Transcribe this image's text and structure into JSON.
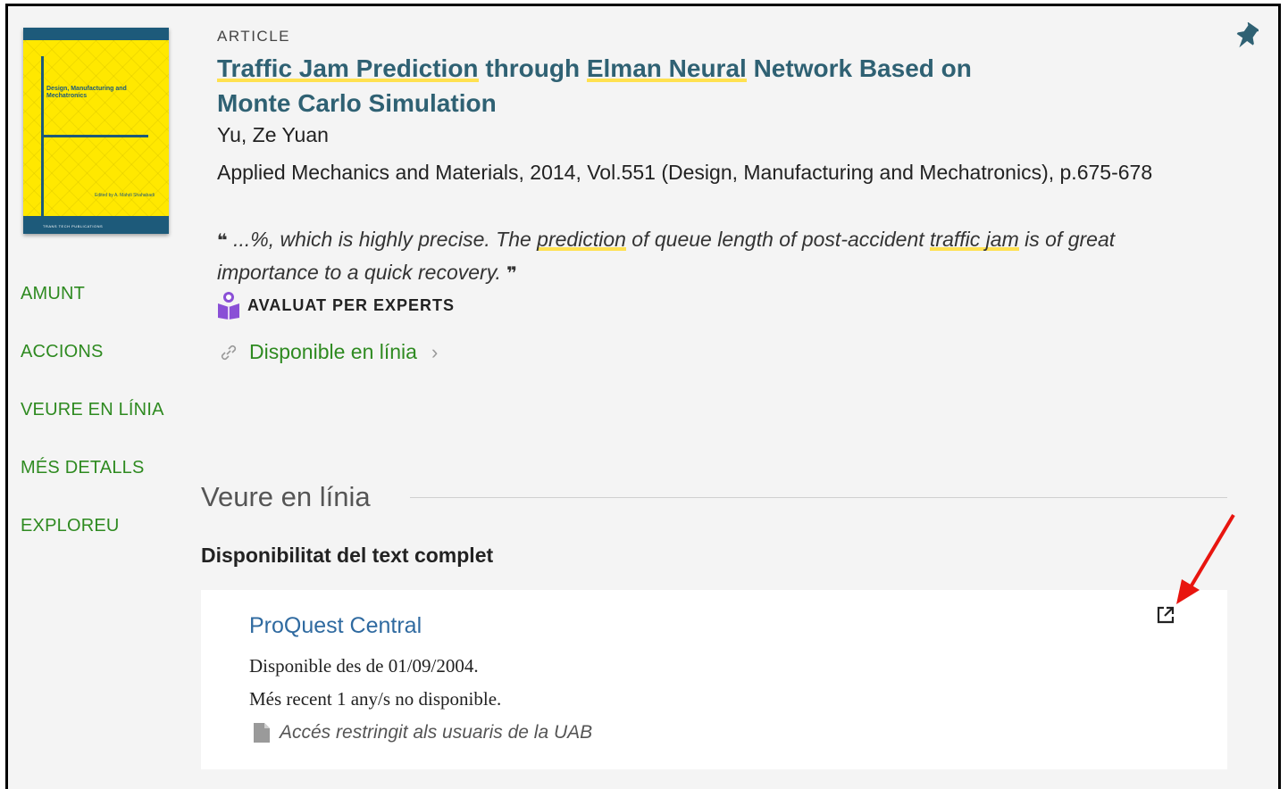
{
  "cover": {
    "title": "Design, Manufacturing and Mechatronics",
    "editor": "Edited by A. Mahdi Shahabadi",
    "publisher": "TRANS TECH PUBLICATIONS"
  },
  "nav": {
    "items": [
      {
        "label": "AMUNT"
      },
      {
        "label": "ACCIONS"
      },
      {
        "label": "VEURE EN LÍNIA"
      },
      {
        "label": "MÉS DETALLS"
      },
      {
        "label": "EXPLOREU"
      }
    ]
  },
  "record": {
    "type": "ARTICLE",
    "title_parts": [
      "Traffic Jam Prediction",
      " through ",
      "Elman Neural",
      " Network Based on Monte Carlo Simulation"
    ],
    "author": "Yu, Ze Yuan",
    "source": "Applied Mechanics and Materials, 2014, Vol.551 (Design, Manufacturing and Mechatronics), p.675-678",
    "snippet_parts": [
      "...%, which is highly precise. The ",
      "prediction",
      " of queue length of post-accident ",
      "traffic jam",
      " is of great importance to a quick recovery."
    ],
    "peer_reviewed": "AVALUAT PER EXPERTS",
    "availability": "Disponible en línia",
    "pin_icon": "pin-icon"
  },
  "online": {
    "section_title": "Veure en línia",
    "fulltext_heading": "Disponibilitat del text complet",
    "provider": "ProQuest Central",
    "coverage": "Disponible des de 01/09/2004.",
    "embargo": "Més recent 1 any/s no disponible.",
    "restriction": "Accés restringit als usuaris de la UAB"
  },
  "colors": {
    "accent_green": "#2e8a20",
    "title_teal": "#2f6173",
    "highlight": "#ffe150",
    "arrow_red": "#e8150f"
  }
}
